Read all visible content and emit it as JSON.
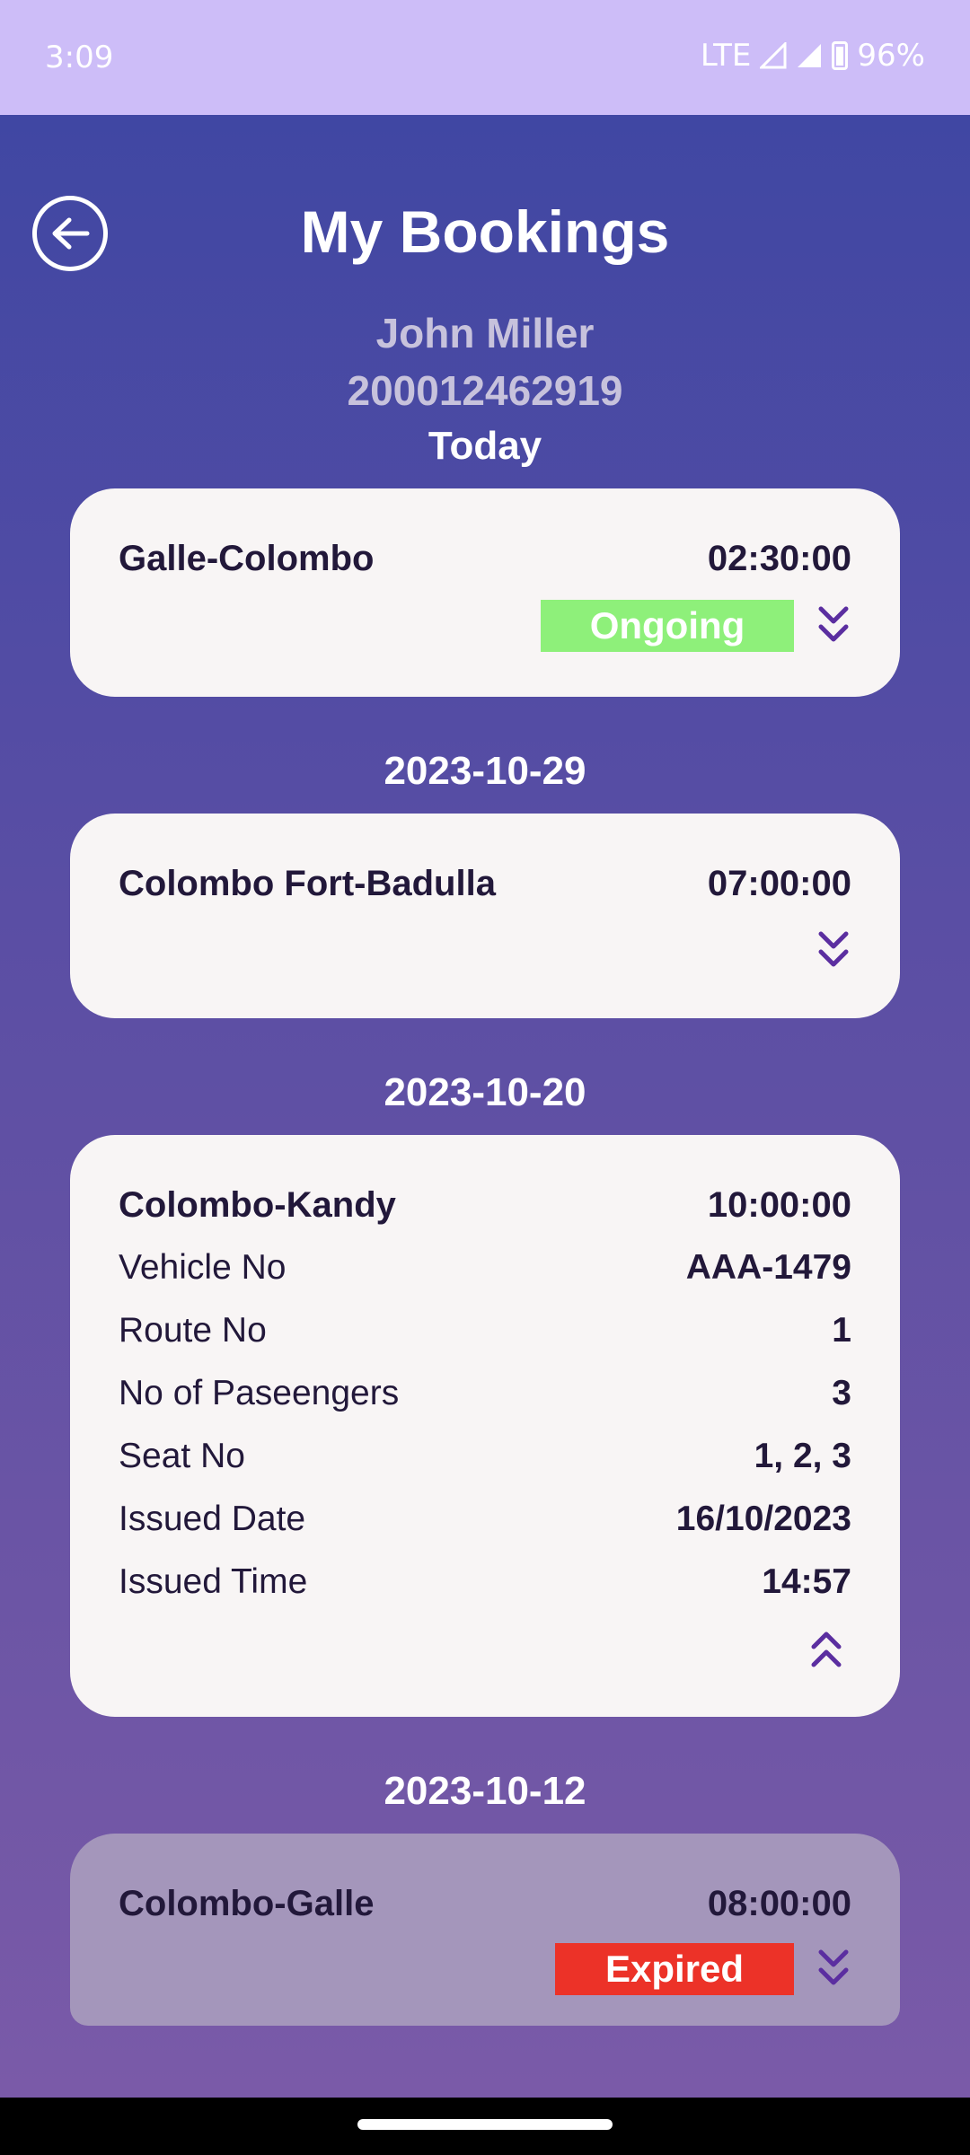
{
  "status_bar": {
    "time": "3:09",
    "network": "LTE",
    "battery": "96%"
  },
  "header": {
    "title": "My Bookings",
    "user_name": "John Miller",
    "user_id": "200012462919"
  },
  "bookings": [
    {
      "date_label": "Today",
      "route": "Galle-Colombo",
      "time": "02:30:00",
      "status": "Ongoing",
      "status_color": "#8ef07a"
    },
    {
      "date_label": "2023-10-29",
      "route": "Colombo Fort-Badulla",
      "time": "07:00:00"
    },
    {
      "date_label": "2023-10-20",
      "route": "Colombo-Kandy",
      "time": "10:00:00",
      "details": [
        {
          "label": "Vehicle No",
          "value": "AAA-1479"
        },
        {
          "label": "Route No",
          "value": "1"
        },
        {
          "label": "No of Paseengers",
          "value": "3"
        },
        {
          "label": "Seat No",
          "value": "1, 2, 3"
        },
        {
          "label": "Issued Date",
          "value": "16/10/2023"
        },
        {
          "label": "Issued Time",
          "value": "14:57"
        }
      ]
    },
    {
      "date_label": "2023-10-12",
      "route": "Colombo-Galle",
      "time": "08:00:00",
      "status": "Expired",
      "status_color": "#ec3228"
    }
  ],
  "colors": {
    "accent": "#5b2ea0",
    "card_bg": "#f8f5f5",
    "expired_card_bg": "#a496bb"
  }
}
